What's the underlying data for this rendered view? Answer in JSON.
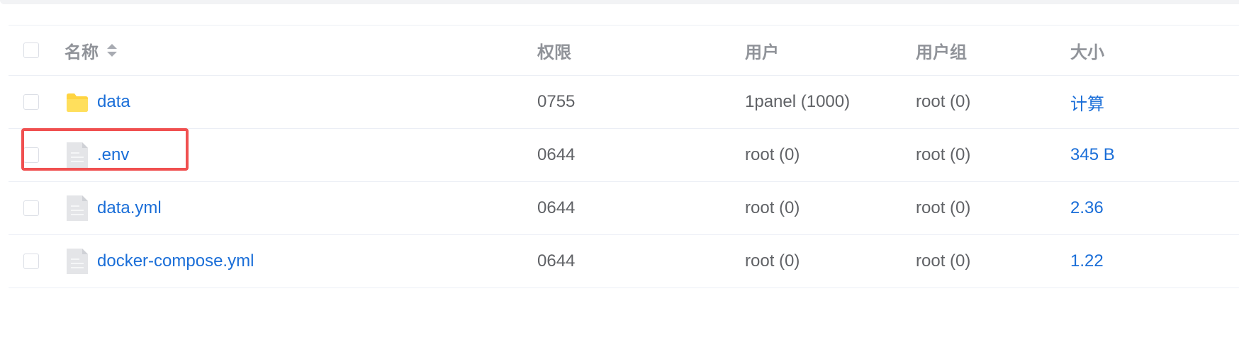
{
  "table": {
    "headers": {
      "name": "名称",
      "permission": "权限",
      "user": "用户",
      "group": "用户组",
      "size": "大小"
    },
    "rows": [
      {
        "type": "folder",
        "name": "data",
        "permission": "0755",
        "user": "1panel (1000)",
        "group": "root (0)",
        "size": "计算"
      },
      {
        "type": "file",
        "name": ".env",
        "permission": "0644",
        "user": "root (0)",
        "group": "root (0)",
        "size": "345 B"
      },
      {
        "type": "file",
        "name": "data.yml",
        "permission": "0644",
        "user": "root (0)",
        "group": "root (0)",
        "size": "2.36"
      },
      {
        "type": "file",
        "name": "docker-compose.yml",
        "permission": "0644",
        "user": "root (0)",
        "group": "root (0)",
        "size": "1.22"
      }
    ]
  },
  "colors": {
    "link": "#1a6ed8",
    "folder": "#ffd440",
    "highlight": "#f05050"
  },
  "icons": {
    "folder": "folder-icon",
    "file": "file-icon",
    "sort": "sort-icon"
  }
}
